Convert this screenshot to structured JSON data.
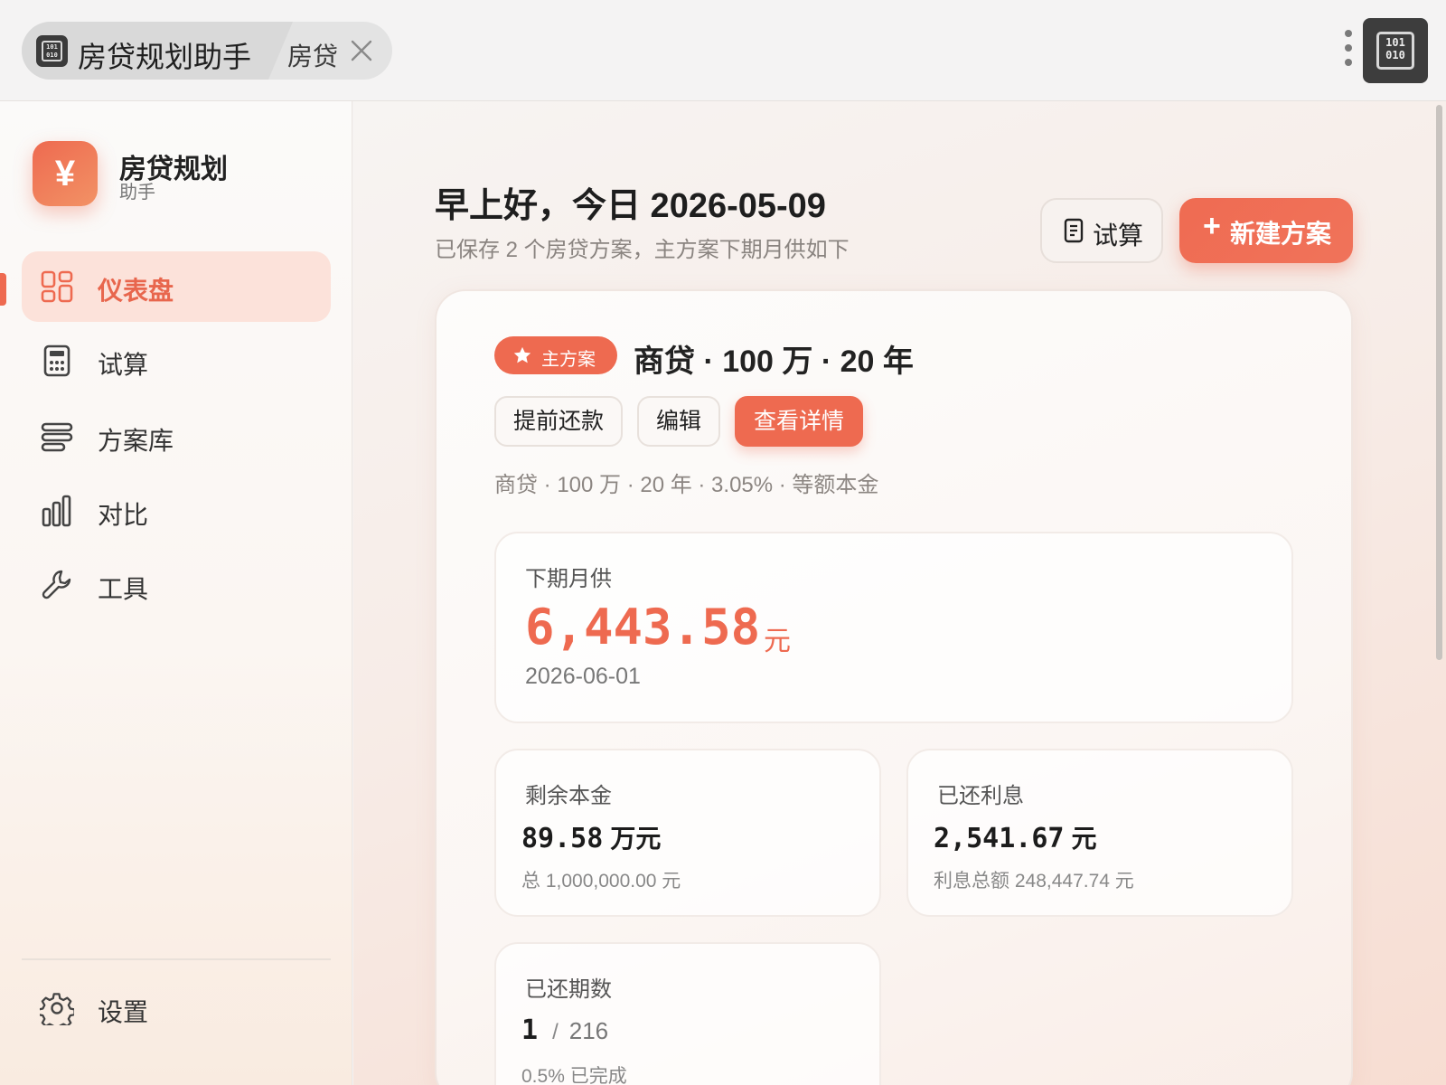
{
  "titlebar": {
    "app_tab_title": "房贷规划助手",
    "secondary_tab_title": "房贷",
    "app_icon_glyph": "101\n010",
    "close_icon": "close-icon",
    "menu_icon": "kebab-icon"
  },
  "sidebar": {
    "brand_logo": "¥",
    "brand_name": "房贷规划",
    "brand_sub": "助手",
    "items": [
      {
        "label": "仪表盘",
        "icon": "dashboard-icon",
        "active": true
      },
      {
        "label": "试算",
        "icon": "calculator-icon",
        "active": false
      },
      {
        "label": "方案库",
        "icon": "stack-icon",
        "active": false
      },
      {
        "label": "对比",
        "icon": "bar-chart-icon",
        "active": false
      },
      {
        "label": "工具",
        "icon": "wrench-icon",
        "active": false
      }
    ],
    "settings_label": "设置"
  },
  "header": {
    "greeting": "早上好，今日 2026-05-09",
    "subtitle": "已保存 2 个房贷方案，主方案下期月供如下",
    "calc_button": "试算",
    "new_button_plus": "+",
    "new_button": "新建方案"
  },
  "plan": {
    "badge": "主方案",
    "title": "商贷 · 100 万 · 20 年",
    "actions": {
      "prepay": "提前还款",
      "edit": "编辑",
      "details": "查看详情"
    },
    "description": "商贷 · 100 万 · 20 年 · 3.05% · 等额本金",
    "next_payment": {
      "label": "下期月供",
      "amount": "6,443.58",
      "unit": "元",
      "date": "2026-06-01"
    },
    "remaining_principal": {
      "label": "剩余本金",
      "value": "89.58",
      "unit": "万元",
      "sub": "总 1,000,000.00 元"
    },
    "paid_interest": {
      "label": "已还利息",
      "value": "2,541.67",
      "unit": "元",
      "sub": "利息总额 248,447.74 元"
    },
    "paid_periods": {
      "label": "已还期数",
      "current": "1",
      "separator": "/",
      "total": "216",
      "sub": "0.5% 已完成",
      "progress": 0.005
    }
  },
  "colors": {
    "accent": "#ee6a50",
    "accent_light": "#fce2da",
    "text": "#222222",
    "muted": "#8c8682"
  }
}
